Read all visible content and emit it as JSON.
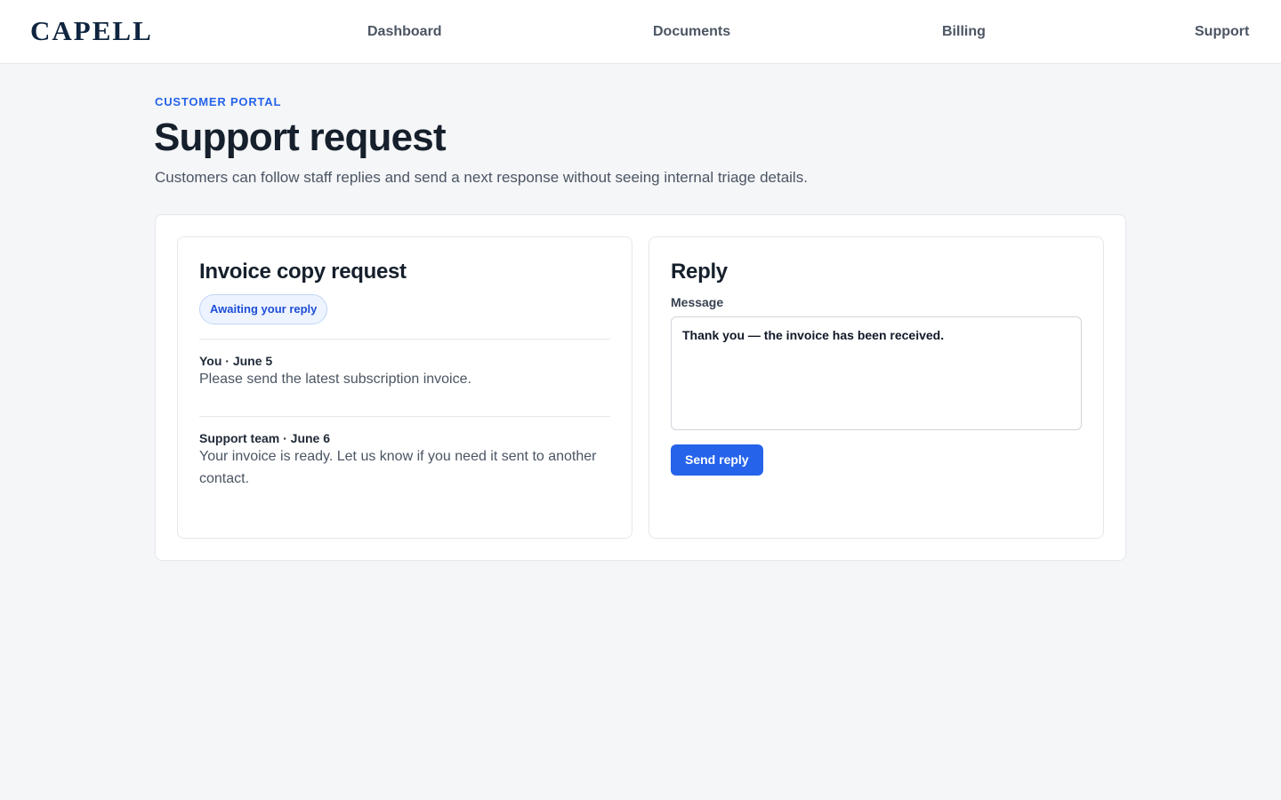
{
  "header": {
    "logo": "CAPELL",
    "nav": {
      "dashboard": "Dashboard",
      "documents": "Documents",
      "billing": "Billing",
      "support": "Support"
    }
  },
  "page": {
    "eyebrow": "CUSTOMER PORTAL",
    "title": "Support request",
    "subtitle": "Customers can follow staff replies and send a next response without seeing internal triage details."
  },
  "request": {
    "title": "Invoice copy request",
    "status": "Awaiting your reply",
    "messages": [
      {
        "meta": "You · June 5",
        "body": "Please send the latest subscription invoice."
      },
      {
        "meta": "Support team · June 6",
        "body": "Your invoice is ready. Let us know if you need it sent to another contact."
      }
    ]
  },
  "reply": {
    "title": "Reply",
    "message_label": "Message",
    "message_value": "Thank you — the invoice has been received.",
    "send_label": "Send reply"
  },
  "colors": {
    "accent": "#2563eb",
    "badge_bg": "#eef4ff",
    "badge_text": "#1d4ed8",
    "logo": "#0f2540"
  }
}
